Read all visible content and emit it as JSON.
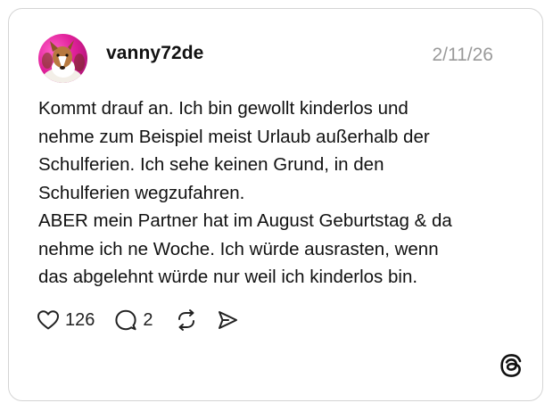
{
  "post": {
    "username": "vanny72de",
    "date": "2/11/26",
    "body_lines": [
      "Kommt drauf an. Ich bin gewollt kinderlos und",
      "nehme zum Beispiel meist Urlaub außerhalb der",
      "Schulferien. Ich sehe keinen Grund, in den",
      "Schulferien wegzufahren.",
      "ABER mein Partner hat im August Geburtstag & da",
      "nehme ich ne Woche. Ich würde ausrasten, wenn",
      "das abgelehnt würde nur weil ich kinderlos bin."
    ]
  },
  "actions": {
    "likes_count": "126",
    "replies_count": "2"
  },
  "icons": {
    "like": "heart-icon",
    "reply": "comment-icon",
    "repost": "repost-icon",
    "share": "send-icon",
    "brand": "threads-logo-icon"
  },
  "colors": {
    "text": "#111111",
    "date": "#9a9a9a",
    "border": "#d4d4d4",
    "avatar_bg": "#e0209a"
  }
}
